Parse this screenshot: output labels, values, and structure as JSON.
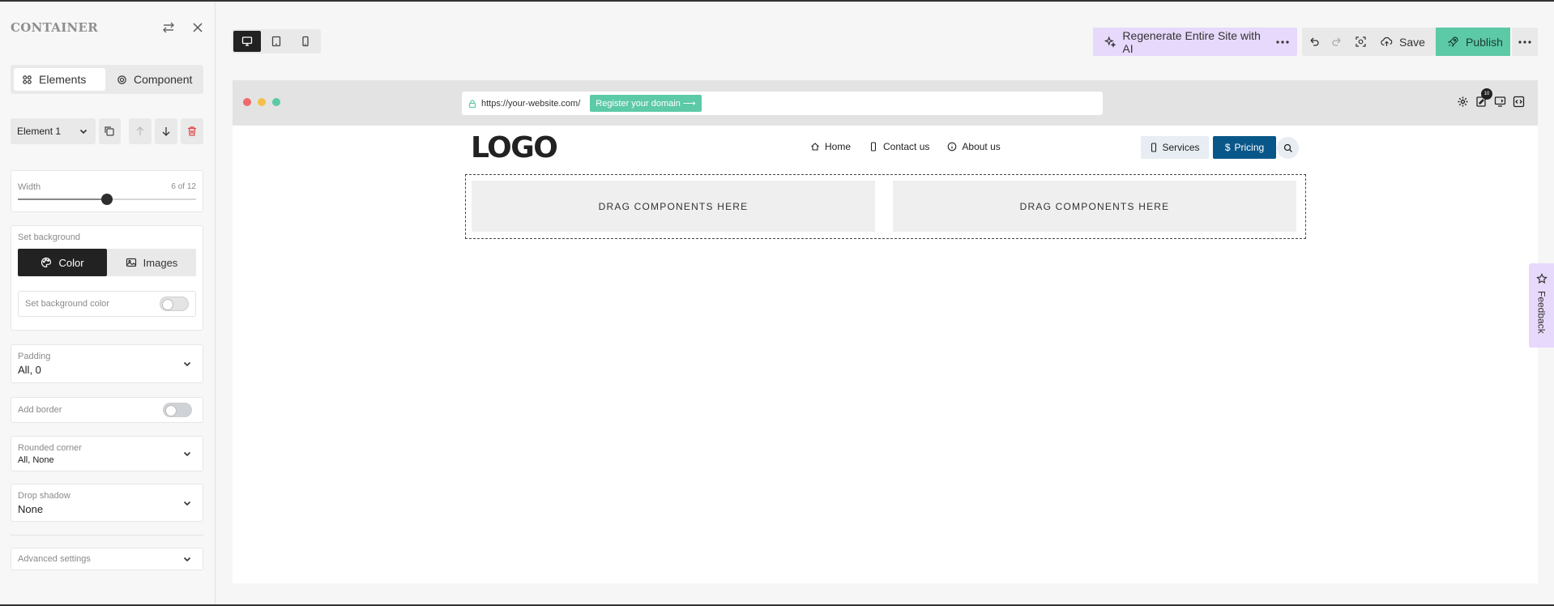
{
  "panel": {
    "title": "CONTAINER",
    "tabs": [
      {
        "label": "Elements"
      },
      {
        "label": "Component"
      }
    ],
    "element_select": "Element 1",
    "width": {
      "label": "Width",
      "value": 6,
      "max": 12,
      "display": "6 of 12"
    },
    "background": {
      "label": "Set background",
      "color_tab": "Color",
      "images_tab": "Images",
      "color_toggle_label": "Set background color"
    },
    "padding": {
      "label": "Padding",
      "value": "All, 0"
    },
    "border": {
      "label": "Add border"
    },
    "rounded": {
      "label": "Rounded corner",
      "value": "All, None"
    },
    "shadow": {
      "label": "Drop shadow",
      "value": "None"
    },
    "advanced": {
      "label": "Advanced settings"
    }
  },
  "toolbar": {
    "regenerate_label": "Regenerate Entire Site with AI",
    "save_label": "Save",
    "publish_label": "Publish"
  },
  "browser": {
    "url": "https://your-website.com/",
    "register_label": "Register your domain ⟶",
    "badge_count": "10",
    "dot_colors": [
      "#ef6b6b",
      "#f5c04a",
      "#5cc9a7"
    ]
  },
  "site": {
    "logo": "LOGO",
    "nav": [
      {
        "label": "Home"
      },
      {
        "label": "Contact us"
      },
      {
        "label": "About us"
      }
    ],
    "services_label": "Services",
    "pricing_label": "Pricing",
    "drop_zones": [
      "DRAG COMPONENTS HERE",
      "DRAG COMPONENTS HERE"
    ]
  },
  "feedback_label": "Feedback",
  "colors": {
    "accent_green": "#5cc9a7",
    "ai_purple": "#e7d9fb",
    "pricing_blue": "#095789"
  }
}
